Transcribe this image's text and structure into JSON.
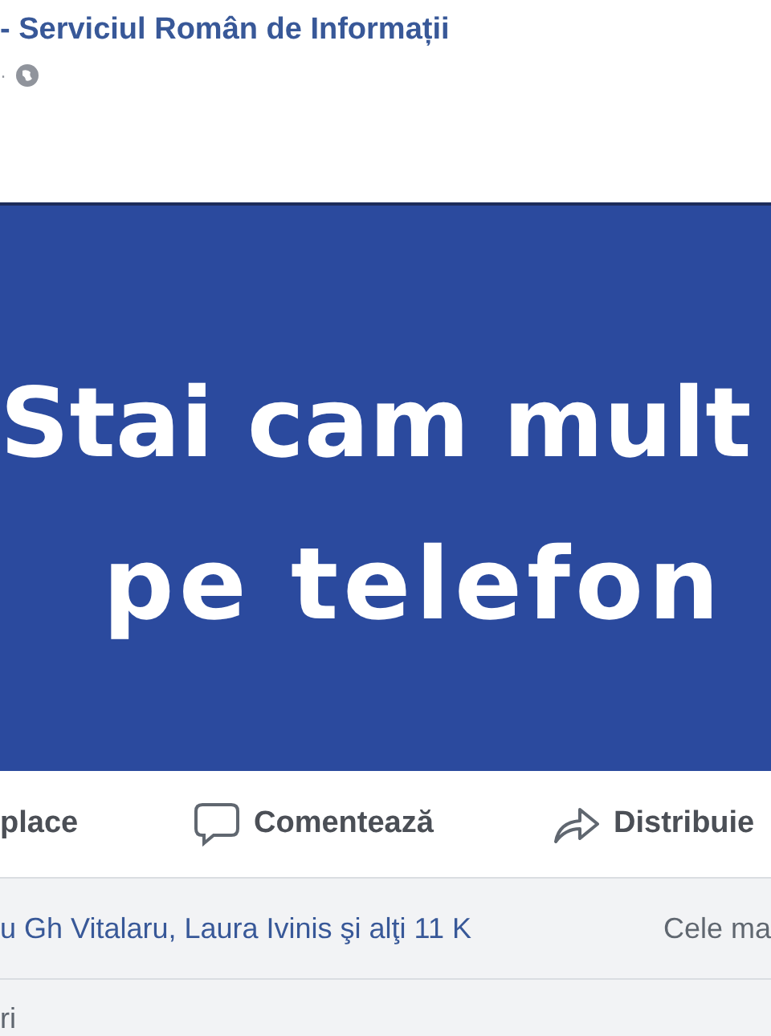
{
  "post": {
    "author": "- Serviciul Român de Informații",
    "meta_separator": "·"
  },
  "image": {
    "lines": [
      "Stai cam mult",
      "pe telefon"
    ]
  },
  "actions": [
    {
      "kind": "like",
      "label": "place"
    },
    {
      "kind": "comment",
      "label": "Comentează"
    },
    {
      "kind": "share",
      "label": "Distribuie"
    }
  ],
  "reactions": {
    "names": "u Gh Vitalaru, Laura Ivinis şi alţi 11 K",
    "sort": "Cele ma"
  },
  "comments": {
    "label": "ri"
  }
}
